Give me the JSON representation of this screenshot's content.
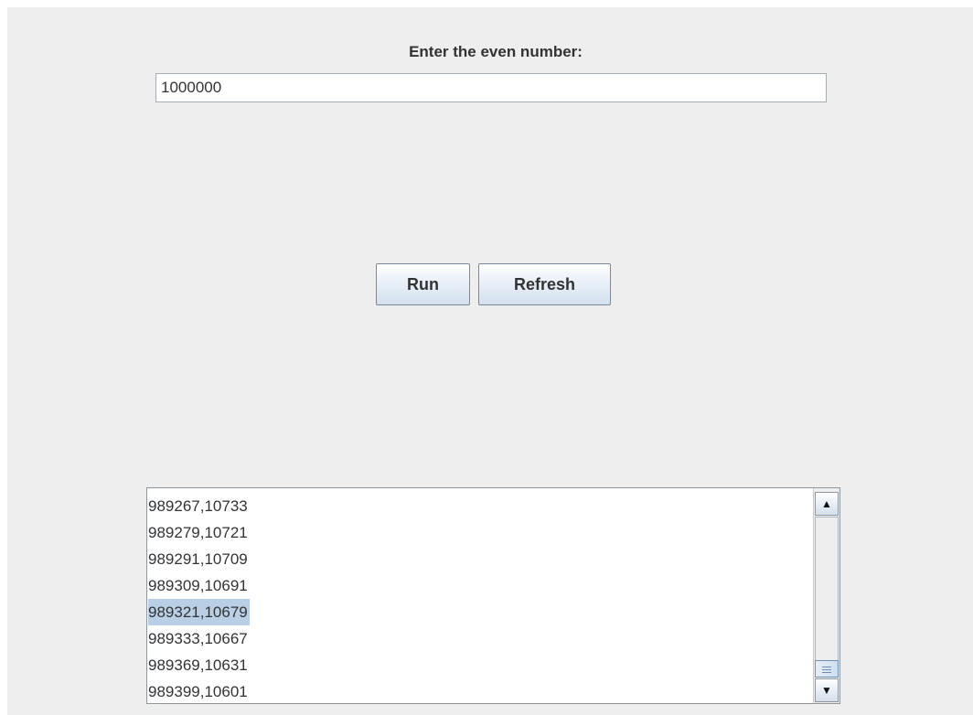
{
  "form": {
    "prompt_label": "Enter the even number:",
    "input_value": "1000000"
  },
  "buttons": {
    "run_label": "Run",
    "refresh_label": "Refresh"
  },
  "results": {
    "items": [
      "989267,10733",
      "989279,10721",
      "989291,10709",
      "989309,10691",
      "989321,10679",
      "989333,10667",
      "989369,10631",
      "989399,10601"
    ],
    "selected_item": "989321,10679",
    "scroll_position_fraction": 1.0,
    "icons": {
      "scroll_up": "triangle-up-icon",
      "scroll_down": "triangle-down-icon",
      "thumb_grip": "grip-lines-icon"
    }
  },
  "colors": {
    "panel_background": "#eeeeee",
    "selection_highlight": "#b8cfe5",
    "text": "#333333"
  }
}
